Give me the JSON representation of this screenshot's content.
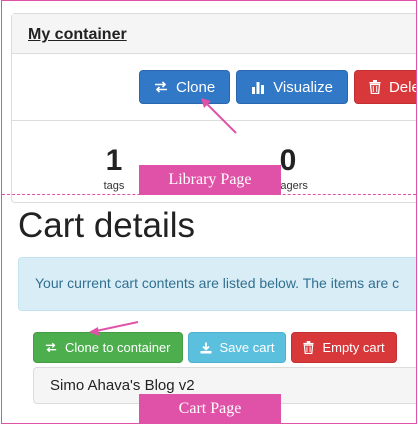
{
  "library": {
    "container_title": "My container",
    "buttons": {
      "clone": "Clone",
      "visualize": "Visualize",
      "delete": "Dele"
    },
    "stats": [
      {
        "value": "1",
        "label": "tags"
      },
      {
        "value": "0",
        "label": "..nagers"
      }
    ],
    "annotation": "Library Page"
  },
  "cart": {
    "title": "Cart details",
    "info": "Your current cart contents are listed below. The items are c",
    "buttons": {
      "clone_to_container": "Clone to container",
      "save_cart": "Save cart",
      "empty_cart": "Empty cart"
    },
    "container_name": "Simo Ahava's Blog v2",
    "annotation": "Cart Page"
  },
  "colors": {
    "annotation": "#e052a8",
    "primary": "#3178c6",
    "danger": "#d9383a",
    "success": "#4cae4c",
    "info": "#5bc0de",
    "alert_bg": "#d9edf7"
  },
  "icons": {
    "clone": "exchange-arrows-icon",
    "visualize": "bar-chart-icon",
    "delete": "trash-icon",
    "save": "download-icon"
  }
}
